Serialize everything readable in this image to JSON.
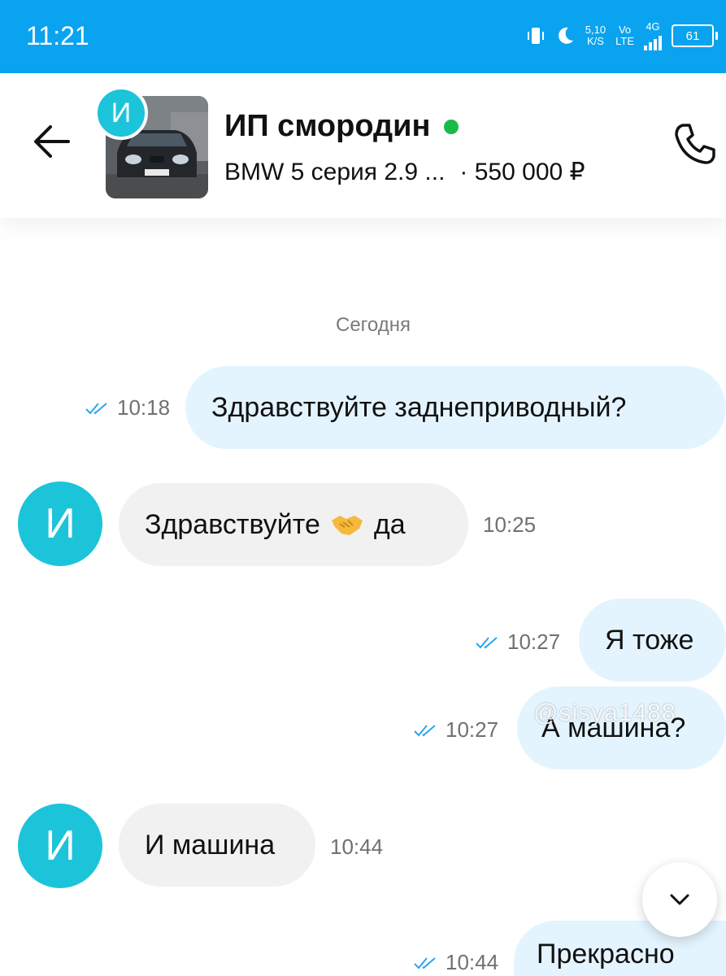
{
  "status_bar": {
    "time": "11:21",
    "net_speed": "5,10",
    "net_unit": "K/S",
    "volte_top": "Vo",
    "volte_bottom": "LTE",
    "network": "4G",
    "battery": "61"
  },
  "header": {
    "avatar_letter": "И",
    "title": "ИП смородин",
    "online_color": "#1bb94a",
    "listing": "BMW 5 серия 2.9 ...",
    "price": "· 550 000 ₽"
  },
  "date_label": "Сегодня",
  "messages": [
    {
      "direction": "out",
      "text": "Здравствуйте заднеприводный?",
      "time": "10:18",
      "read": true
    },
    {
      "direction": "in",
      "avatar_letter": "И",
      "text_before": "Здравствуйте",
      "emoji": "handshake",
      "text_after": "да",
      "time": "10:25"
    },
    {
      "direction": "out",
      "text": "Я тоже",
      "time": "10:27",
      "read": true
    },
    {
      "direction": "out",
      "text": "А машина?",
      "time": "10:27",
      "read": true
    },
    {
      "direction": "in",
      "avatar_letter": "И",
      "text": "И машина",
      "time": "10:44"
    },
    {
      "direction": "out",
      "text": "Прекрасно",
      "time": "10:44",
      "read": true
    }
  ],
  "watermark": "@sisya1488",
  "colors": {
    "status_bar": "#0aa3f0",
    "outgoing_bubble": "#e4f4fe",
    "incoming_bubble": "#f1f1f1",
    "avatar": "#1cc4d9",
    "read_ticks": "#2aa4f0"
  },
  "icons": {
    "back": "arrow-left-icon",
    "call": "phone-icon",
    "scroll_down": "chevron-down-icon",
    "read": "double-check-icon"
  }
}
